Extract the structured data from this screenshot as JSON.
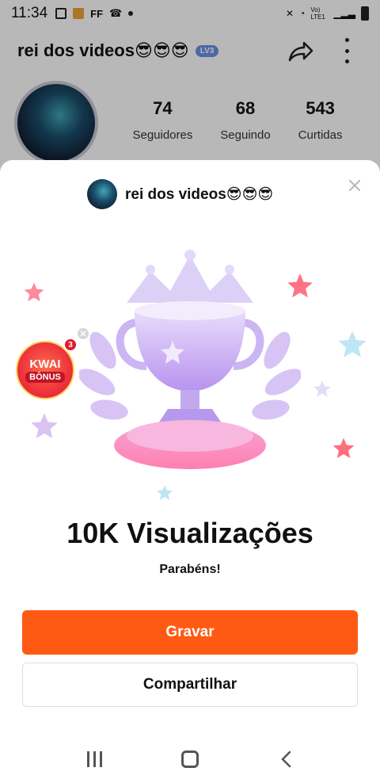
{
  "status_bar": {
    "time": "11:34",
    "app_icons": [
      "image-icon",
      "app-icon",
      "FF",
      "missed-call-icon"
    ],
    "ff_label": "FF",
    "network_label": "Vo) LTE1"
  },
  "profile": {
    "name": "rei dos videos😎😎😎",
    "level_badge": "LV3",
    "stats": [
      {
        "value": "74",
        "label": "Seguidores"
      },
      {
        "value": "68",
        "label": "Seguindo"
      },
      {
        "value": "543",
        "label": "Curtidas"
      }
    ]
  },
  "sheet": {
    "username": "rei dos videos😎😎😎",
    "title": "10K Visualizações",
    "subtitle": "Parabéns!",
    "primary_button": "Gravar",
    "secondary_button": "Compartilhar"
  },
  "bonus": {
    "title": "KWAI",
    "subtitle": "BÔNUS",
    "count": "3"
  },
  "colors": {
    "accent": "#ff5a14",
    "trophy": "#c9a6f2",
    "bonus_red": "#ea2a3a"
  }
}
